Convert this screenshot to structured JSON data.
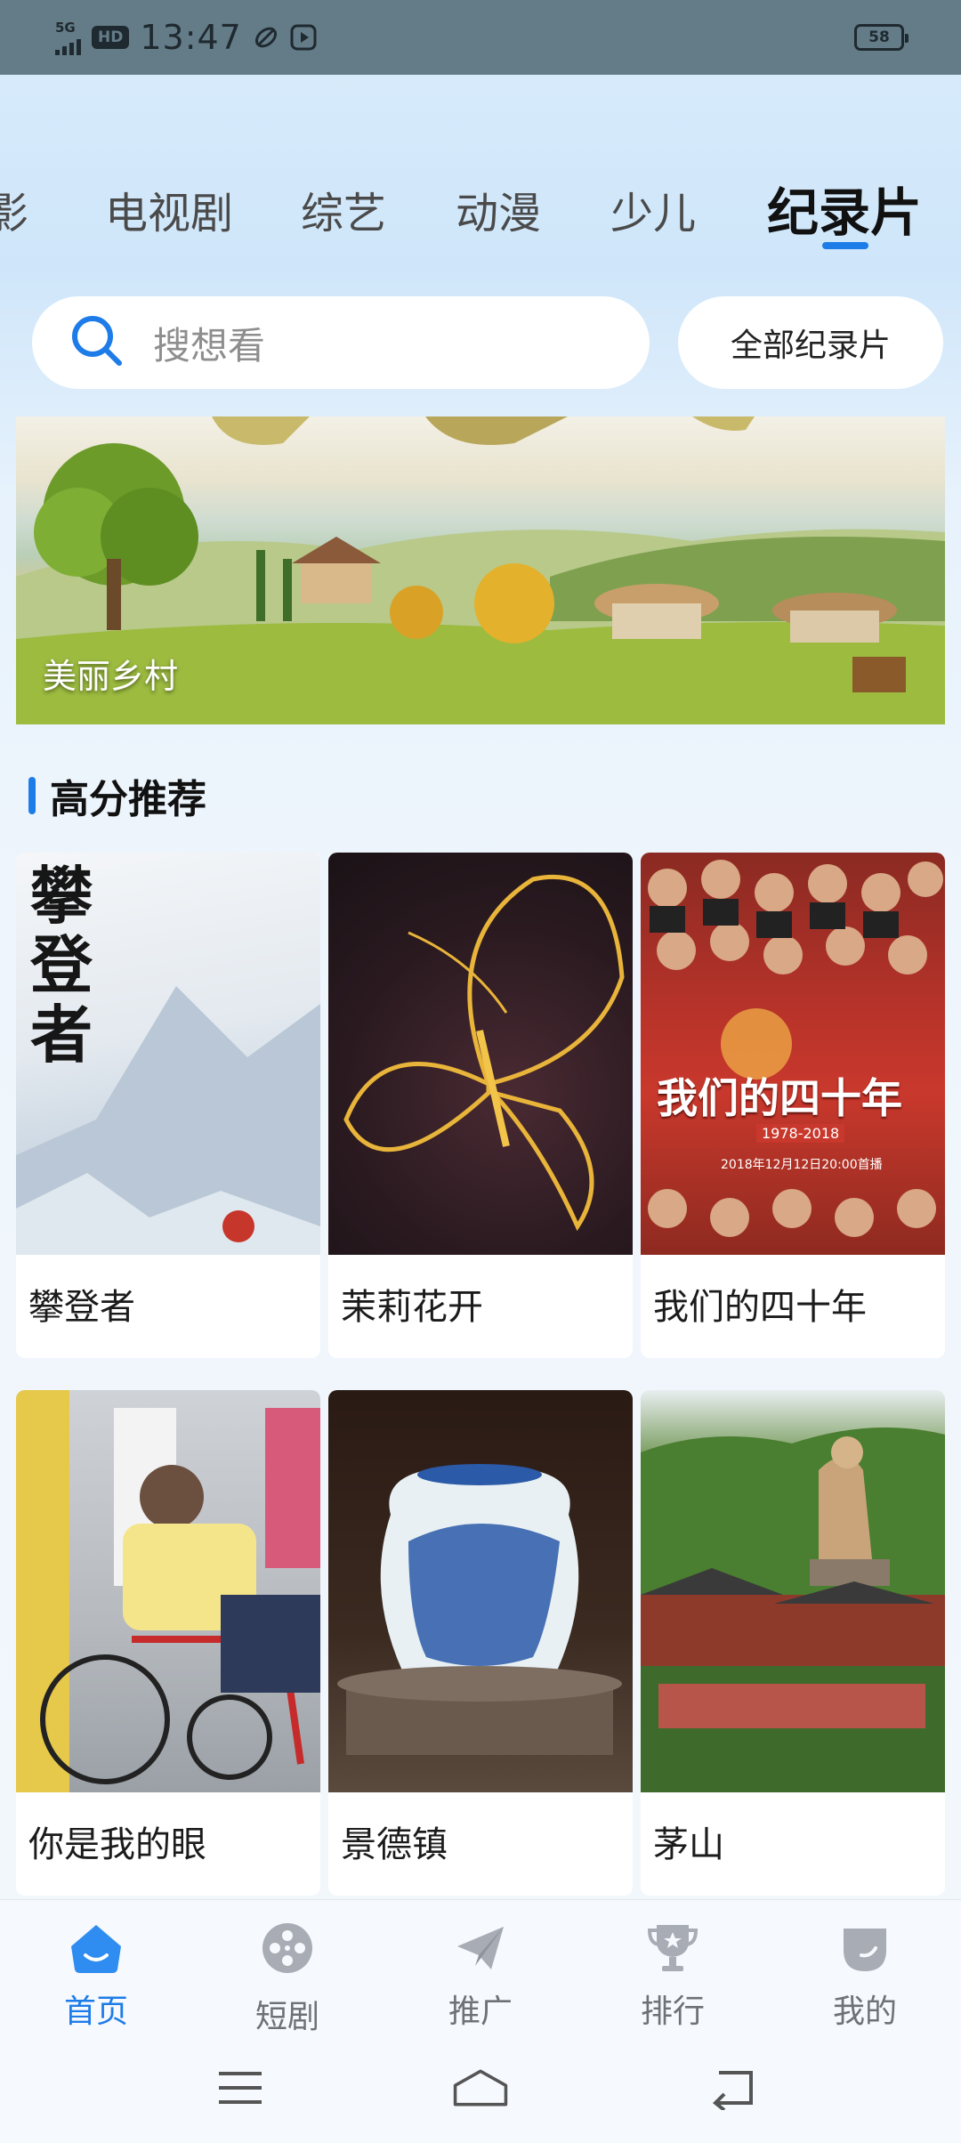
{
  "status_bar": {
    "network": "5G",
    "hd": "HD",
    "time": "13:47",
    "battery": "58"
  },
  "tabs": [
    {
      "label": "影",
      "active": false
    },
    {
      "label": "电视剧",
      "active": false
    },
    {
      "label": "综艺",
      "active": false
    },
    {
      "label": "动漫",
      "active": false
    },
    {
      "label": "少儿",
      "active": false
    },
    {
      "label": "纪录片",
      "active": true
    }
  ],
  "search": {
    "placeholder": "搜想看",
    "all_button": "全部纪录片"
  },
  "banner": {
    "caption": "美丽乡村"
  },
  "section": {
    "title": "高分推荐"
  },
  "items": [
    {
      "title": "攀登者",
      "poster_text": "攀登者"
    },
    {
      "title": "茉莉花开"
    },
    {
      "title": "我们的四十年",
      "poster_text": "我们的四十年",
      "poster_date": "2018年12月12日20:00首播",
      "poster_years": "1978-2018"
    },
    {
      "title": "你是我的眼"
    },
    {
      "title": "景德镇"
    },
    {
      "title": "茅山"
    }
  ],
  "bottom_nav": [
    {
      "label": "首页",
      "icon": "home-icon",
      "active": true
    },
    {
      "label": "短剧",
      "icon": "film-reel-icon",
      "active": false
    },
    {
      "label": "推广",
      "icon": "paper-plane-icon",
      "active": false
    },
    {
      "label": "排行",
      "icon": "trophy-icon",
      "active": false
    },
    {
      "label": "我的",
      "icon": "profile-icon",
      "active": false
    }
  ],
  "colors": {
    "accent": "#1e7ce8",
    "status_bar": "#647c88"
  }
}
